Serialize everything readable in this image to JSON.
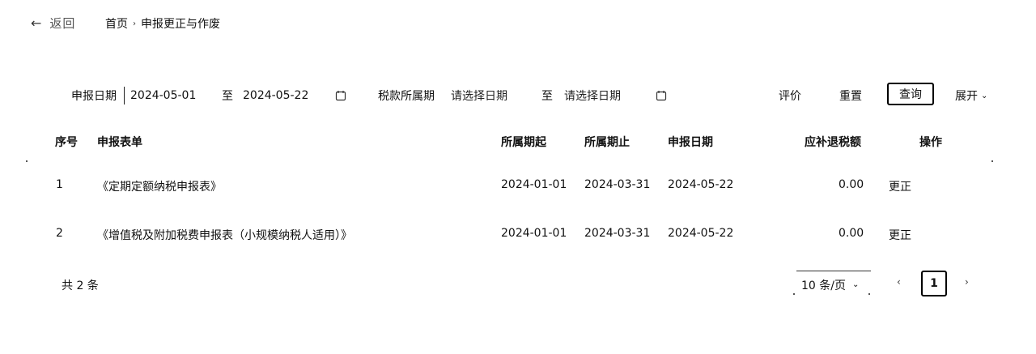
{
  "header": {
    "back_label": "返回",
    "breadcrumb": [
      "首页",
      "申报更正与作废"
    ]
  },
  "filters": {
    "declare_date_label": "申报日期",
    "declare_start": "2024-05-01",
    "to_label": "至",
    "declare_end": "2024-05-22",
    "tax_period_label": "税款所属期",
    "tax_start_placeholder": "请选择日期",
    "tax_to_label": "至",
    "tax_end_placeholder": "请选择日期"
  },
  "actions": {
    "evaluate": "评价",
    "reset": "重置",
    "query": "查询",
    "expand": "展开"
  },
  "table": {
    "columns": [
      "序号",
      "申报表单",
      "所属期起",
      "所属期止",
      "申报日期",
      "应补退税额",
      "操作"
    ],
    "rows": [
      {
        "index": "1",
        "form": "《定期定额纳税申报表》",
        "start": "2024-01-01",
        "end": "2024-03-31",
        "date": "2024-05-22",
        "amount": "0.00",
        "action": "更正"
      },
      {
        "index": "2",
        "form": "《增值税及附加税费申报表（小规模纳税人适用）》",
        "start": "2024-01-01",
        "end": "2024-03-31",
        "date": "2024-05-22",
        "amount": "0.00",
        "action": "更正"
      }
    ]
  },
  "footer": {
    "total": "共 2 条",
    "page_size": "10 条/页",
    "current_page": "1"
  }
}
